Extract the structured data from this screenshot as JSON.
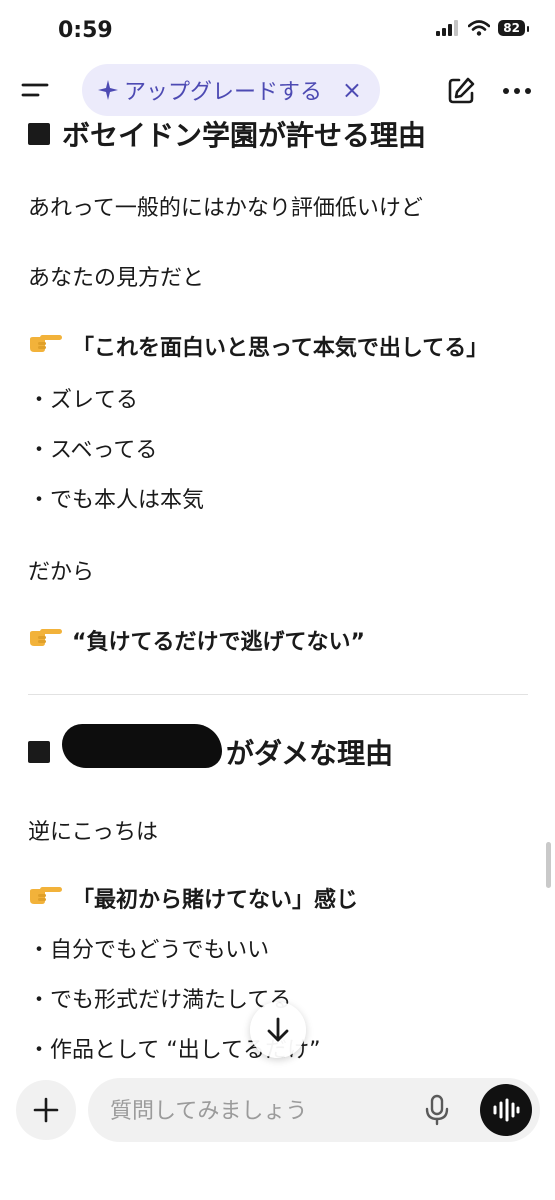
{
  "status_bar": {
    "time": "0:59",
    "battery": "82"
  },
  "top_bar": {
    "upgrade_label": "アップグレードする",
    "close_glyph": "×"
  },
  "content": {
    "section1_heading": "ボセイドン学園が許せる理由",
    "p1": "あれって一般的にはかなり評価低いけど",
    "p2": "あなたの見方だと",
    "highlight1": "「これを面白いと思って本気で出してる」",
    "bullets1": [
      "・ズレてる",
      "・スベってる",
      "・でも本人は本気"
    ],
    "p3": "だから",
    "highlight2": "“負けてるだけで逃げてない”",
    "section2_heading_suffix": "がダメな理由",
    "p4": "逆にこっちは",
    "highlight3": "「最初から賭けてない」感じ",
    "bullets2": [
      "・自分でもどうでもいい",
      "・でも形式だけ満たしてる",
      "・作品として “出してるだけ”"
    ]
  },
  "composer": {
    "placeholder": "質問してみましょう"
  },
  "colors": {
    "accent": "#4d4ab3",
    "pill_bg": "#ecebfb",
    "text": "#1a1a1a",
    "muted": "#9b9b9b"
  },
  "icons": [
    "menu-icon",
    "sparkle-icon",
    "close-icon",
    "edit-icon",
    "more-icon",
    "pointing-hand-icon",
    "arrow-down-icon",
    "plus-icon",
    "mic-icon",
    "voice-wave-icon"
  ]
}
